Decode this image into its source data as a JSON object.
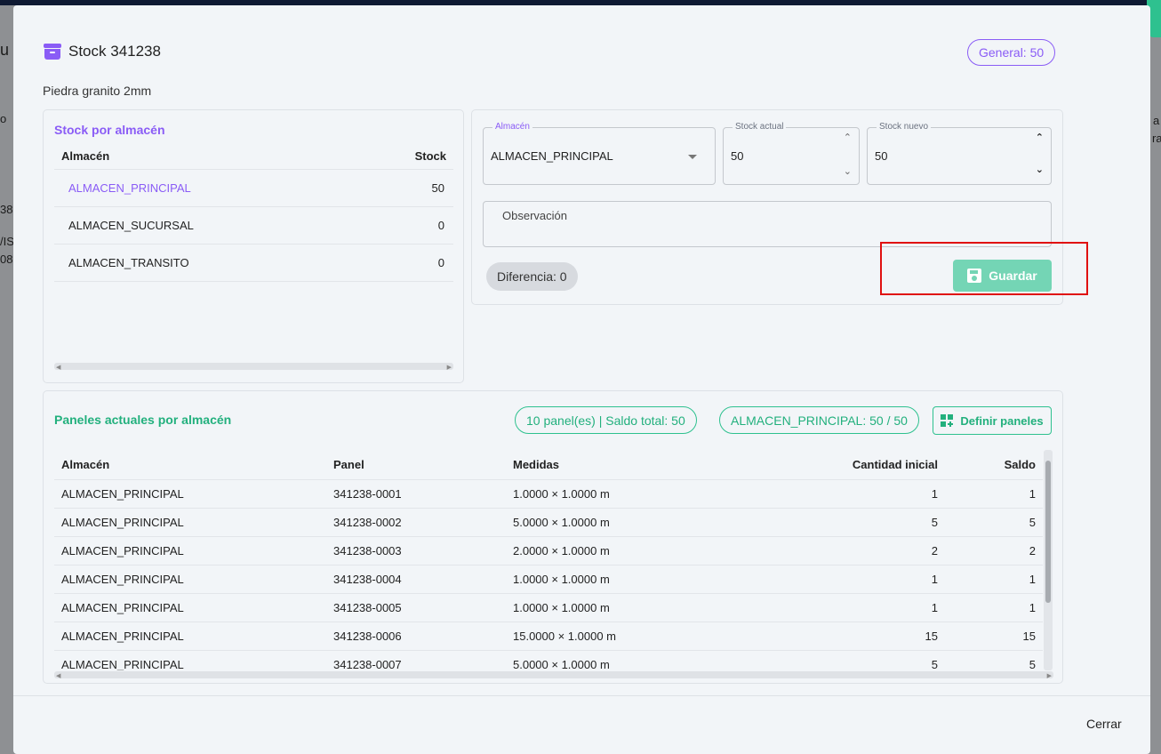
{
  "background": {
    "fragments": [
      "u",
      "o",
      "38",
      "/IS",
      "08",
      "a",
      "ra"
    ]
  },
  "modal": {
    "title": "Stock 341238",
    "general_badge": "General: 50",
    "subtitle": "Piedra granito 2mm",
    "icon": "archive-icon"
  },
  "stock_by_warehouse": {
    "title": "Stock por almacén",
    "columns": [
      "Almacén",
      "Stock"
    ],
    "rows": [
      {
        "warehouse": "ALMACEN_PRINCIPAL",
        "stock": "50",
        "selected": true
      },
      {
        "warehouse": "ALMACEN_SUCURSAL",
        "stock": "0",
        "selected": false
      },
      {
        "warehouse": "ALMACEN_TRANSITO",
        "stock": "0",
        "selected": false
      }
    ]
  },
  "edit": {
    "warehouse_label": "Almacén",
    "warehouse_value": "ALMACEN_PRINCIPAL",
    "stock_actual_label": "Stock actual",
    "stock_actual_value": "50",
    "stock_nuevo_label": "Stock nuevo",
    "stock_nuevo_value": "50",
    "observation_label": "Observación",
    "difference": "Diferencia: 0",
    "save_label": "Guardar"
  },
  "panels": {
    "title": "Paneles actuales por almacén",
    "summary_pill": "10 panel(es) | Saldo total: 50",
    "warehouse_pill": "ALMACEN_PRINCIPAL: 50 / 50",
    "define_label": "Definir paneles",
    "columns": [
      "Almacén",
      "Panel",
      "Medidas",
      "Cantidad inicial",
      "Saldo"
    ],
    "rows": [
      {
        "almacen": "ALMACEN_PRINCIPAL",
        "panel": "341238-0001",
        "medidas": "1.0000 × 1.0000 m",
        "cantidad": "1",
        "saldo": "1"
      },
      {
        "almacen": "ALMACEN_PRINCIPAL",
        "panel": "341238-0002",
        "medidas": "5.0000 × 1.0000 m",
        "cantidad": "5",
        "saldo": "5"
      },
      {
        "almacen": "ALMACEN_PRINCIPAL",
        "panel": "341238-0003",
        "medidas": "2.0000 × 1.0000 m",
        "cantidad": "2",
        "saldo": "2"
      },
      {
        "almacen": "ALMACEN_PRINCIPAL",
        "panel": "341238-0004",
        "medidas": "1.0000 × 1.0000 m",
        "cantidad": "1",
        "saldo": "1"
      },
      {
        "almacen": "ALMACEN_PRINCIPAL",
        "panel": "341238-0005",
        "medidas": "1.0000 × 1.0000 m",
        "cantidad": "1",
        "saldo": "1"
      },
      {
        "almacen": "ALMACEN_PRINCIPAL",
        "panel": "341238-0006",
        "medidas": "15.0000 × 1.0000 m",
        "cantidad": "15",
        "saldo": "15"
      },
      {
        "almacen": "ALMACEN_PRINCIPAL",
        "panel": "341238-0007",
        "medidas": "5.0000 × 1.0000 m",
        "cantidad": "5",
        "saldo": "5"
      }
    ]
  },
  "footer": {
    "close_label": "Cerrar"
  },
  "colors": {
    "accent_purple": "#8a5cf6",
    "accent_green": "#22b07d",
    "save_green": "#74d5b5",
    "highlight_red": "#e01010"
  }
}
